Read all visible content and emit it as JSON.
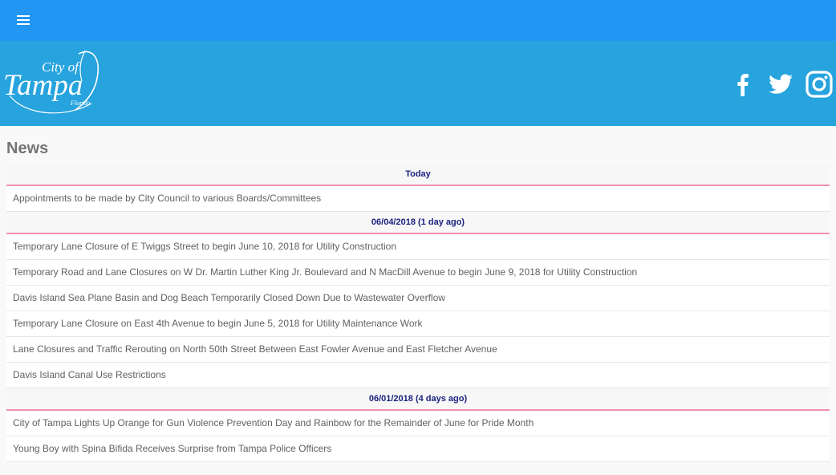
{
  "appbar": {
    "menu_icon": "hamburger-menu-icon"
  },
  "banner": {
    "logo": {
      "city_of": "City of",
      "name": "Tampa",
      "state": "Florida"
    },
    "social": [
      {
        "name": "facebook-icon"
      },
      {
        "name": "twitter-icon"
      },
      {
        "name": "instagram-icon"
      }
    ]
  },
  "colors": {
    "appbar": "#2196f3",
    "banner": "#27a3de",
    "date_header_text": "#1a237e",
    "divider_accent": "#f48fb1"
  },
  "page": {
    "title": "News"
  },
  "news": {
    "groups": [
      {
        "date": "Today",
        "items": [
          "Appointments to be made by City Council to various Boards/Committees"
        ]
      },
      {
        "date": "06/04/2018 (1 day ago)",
        "items": [
          "Temporary Lane Closure of E Twiggs Street to begin June 10, 2018 for Utility Construction",
          "Temporary Road and Lane Closures on W Dr. Martin Luther King Jr. Boulevard and N MacDill Avenue to begin June 9, 2018 for Utility Construction",
          "Davis Island Sea Plane Basin and Dog Beach Temporarily Closed Down Due to Wastewater Overflow",
          "Temporary Lane Closure on East 4th Avenue to begin June 5, 2018 for Utility Maintenance Work",
          "Lane Closures and Traffic Rerouting on North 50th Street  Between East Fowler Avenue and East Fletcher Avenue",
          "Davis Island Canal Use Restrictions"
        ]
      },
      {
        "date": "06/01/2018 (4 days ago)",
        "items": [
          "City of Tampa Lights Up Orange for Gun Violence Prevention Day and Rainbow for the Remainder of June for Pride Month",
          "Young Boy with Spina Bifida Receives Surprise from Tampa Police Officers"
        ]
      }
    ]
  }
}
